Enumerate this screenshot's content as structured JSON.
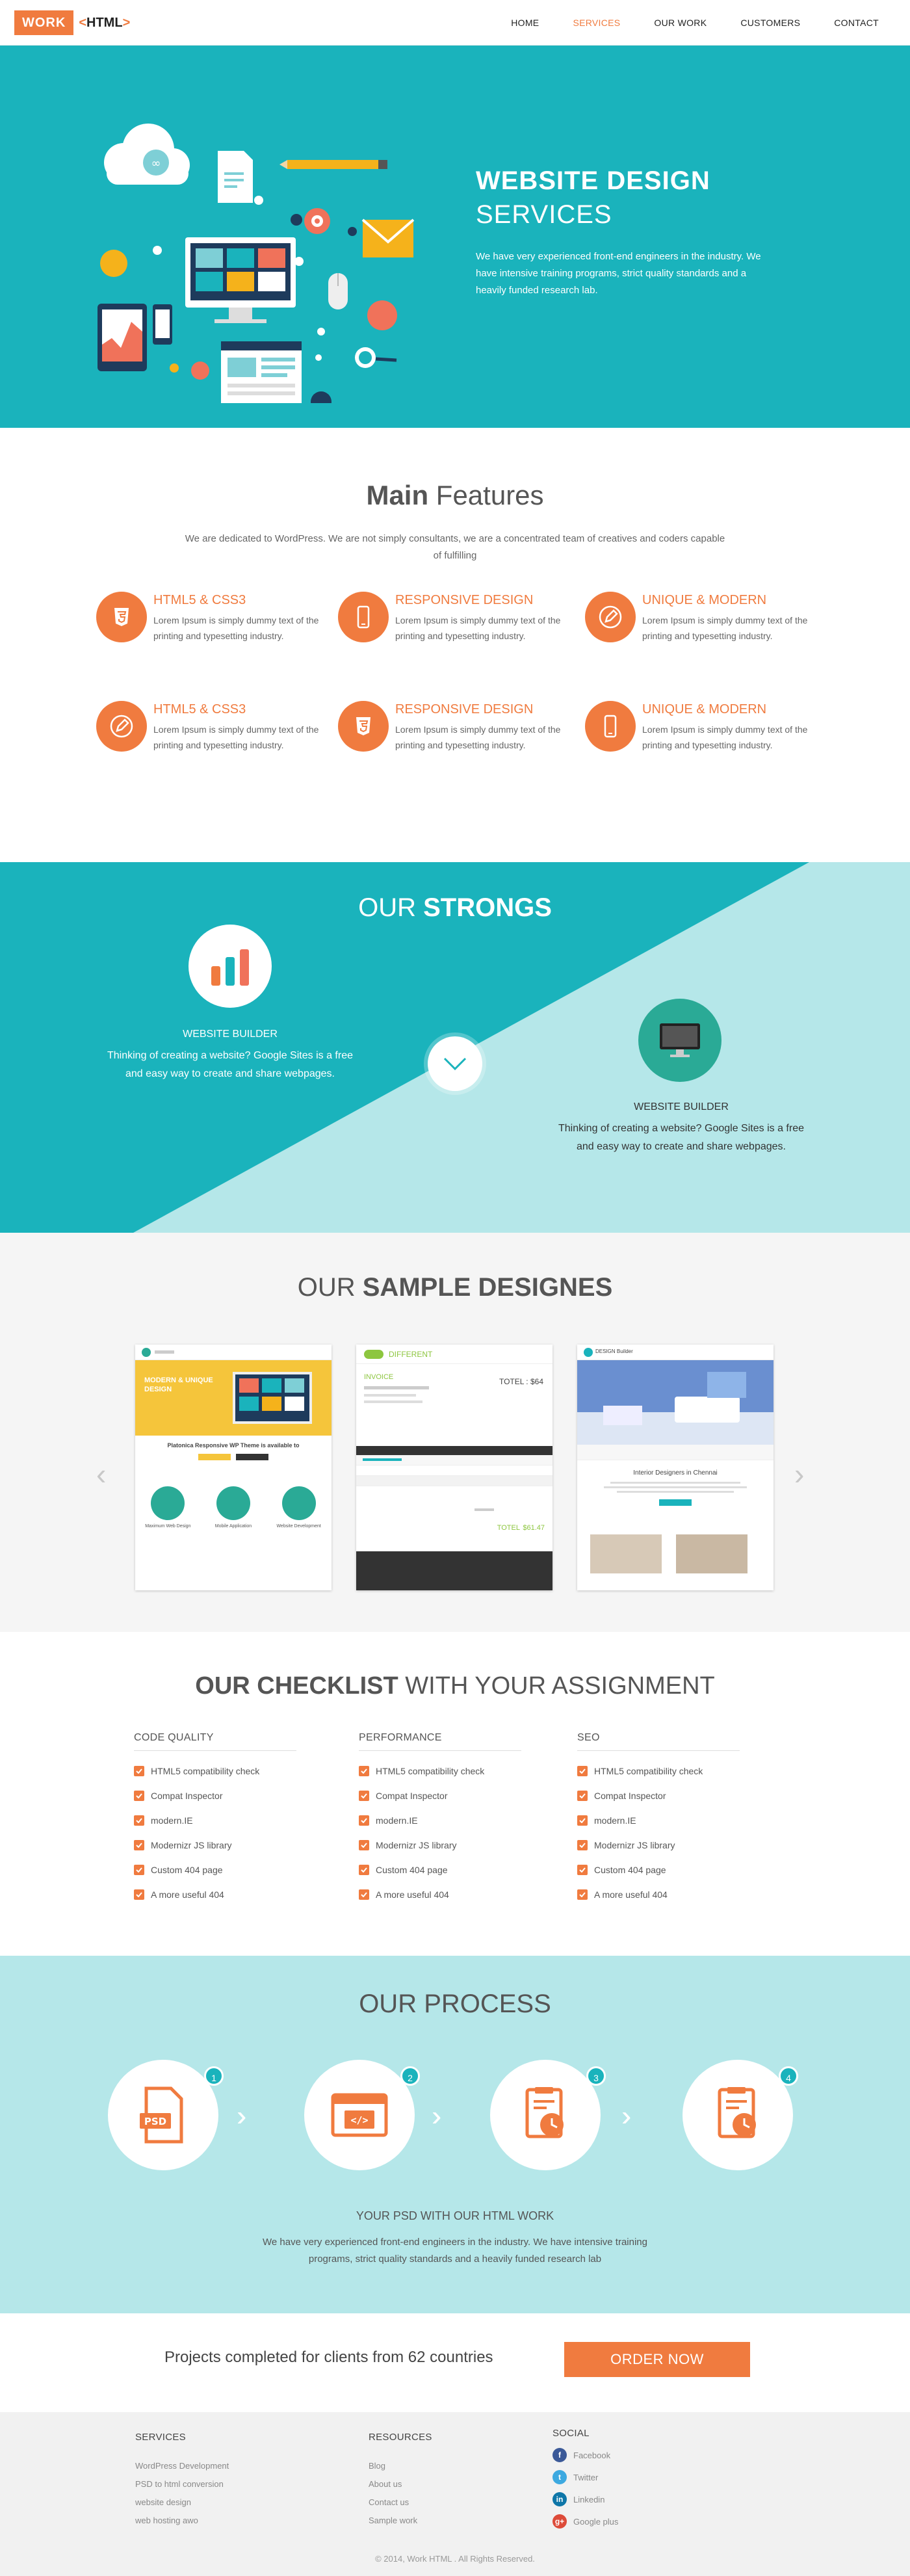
{
  "header": {
    "logo_work": "WORK",
    "logo_html": "HTML",
    "nav": [
      "HOME",
      "SERVICES",
      "OUR WORK",
      "CUSTOMERS",
      "CONTACT"
    ],
    "active_nav": "SERVICES"
  },
  "hero": {
    "title_bold": "WEBSITE DESIGN",
    "title_light": "SERVICES",
    "description": "We have very experienced front-end engineers in the industry. We have intensive training programs, strict quality standards and a heavily funded research lab."
  },
  "features": {
    "title_bold": "Main",
    "title_light": "Features",
    "subtitle": "We are dedicated to WordPress. We are not simply consultants, we are a concentrated team of creatives and coders capable of fulfilling",
    "items": [
      {
        "icon": "html5-icon",
        "title": "HTML5 & CSS3",
        "text": "Lorem Ipsum is simply dummy text of the printing and typesetting industry."
      },
      {
        "icon": "smartphone-icon",
        "title": "RESPONSIVE DESIGN",
        "text": "Lorem Ipsum is simply dummy text of the printing and typesetting industry."
      },
      {
        "icon": "pencil-icon",
        "title": "UNIQUE & MODERN",
        "text": "Lorem Ipsum is simply dummy text of the printing and typesetting industry."
      },
      {
        "icon": "pencil-icon",
        "title": "HTML5 & CSS3",
        "text": "Lorem Ipsum is simply dummy text of the printing and typesetting industry."
      },
      {
        "icon": "html5-icon",
        "title": "RESPONSIVE DESIGN",
        "text": "Lorem Ipsum is simply dummy text of the printing and typesetting industry."
      },
      {
        "icon": "smartphone-icon",
        "title": "UNIQUE & MODERN",
        "text": "Lorem Ipsum is simply dummy text of the printing and typesetting industry."
      }
    ]
  },
  "strongs": {
    "title_light": "OUR",
    "title_bold": "STRONGS",
    "items": [
      {
        "icon": "bar-chart-icon",
        "label": "WEBSITE BUILDER",
        "text": "Thinking of creating a website? Google Sites is a free and easy way to create and share webpages."
      },
      {
        "icon": "monitor-icon",
        "label": "WEBSITE BUILDER",
        "text": "Thinking of creating a website? Google Sites is a free and easy way to create and share webpages."
      }
    ]
  },
  "samples": {
    "title_light": "OUR",
    "title_bold": "SAMPLE DESIGNES",
    "card1": {
      "hero_text": "MODERN & UNIQUE DESIGN",
      "headline": "Platonica Responsive WP Theme is available to",
      "features": [
        "Maximum Web Design",
        "Mobile Application",
        "Website Development"
      ]
    },
    "card2": {
      "brand": "DIFFERENT",
      "heading": "INVOICE",
      "total": "TOTEL : $64",
      "footer_total_label": "TOTEL",
      "footer_total": "$61.47"
    },
    "card3": {
      "brand": "DESIGN Builder",
      "headline": "Interior Designers in Chennai"
    }
  },
  "checklist": {
    "title_bold": "OUR CHECKLIST",
    "title_light": "WITH YOUR ASSIGNMENT",
    "columns": [
      {
        "heading": "CODE QUALITY",
        "items": [
          "HTML5 compatibility check",
          "Compat Inspector",
          "modern.IE",
          "Modernizr JS library",
          "Custom 404 page",
          "A more useful 404"
        ]
      },
      {
        "heading": "PERFORMANCE",
        "items": [
          "HTML5 compatibility check",
          "Compat Inspector",
          "modern.IE",
          "Modernizr JS library",
          "Custom 404 page",
          "A more useful 404"
        ]
      },
      {
        "heading": "SEO",
        "items": [
          "HTML5 compatibility check",
          "Compat Inspector",
          "modern.IE",
          "Modernizr JS library",
          "Custom 404 page",
          "A more useful 404"
        ]
      }
    ]
  },
  "process": {
    "title": "OUR PROCESS",
    "steps": [
      {
        "num": "1",
        "icon": "psd-file-icon"
      },
      {
        "num": "2",
        "icon": "code-window-icon"
      },
      {
        "num": "3",
        "icon": "document-clock-icon"
      },
      {
        "num": "4",
        "icon": "document-clock-icon"
      }
    ],
    "label": "YOUR PSD WITH OUR HTML WORK",
    "description": "We have very experienced front-end engineers in the industry. We have intensive training programs, strict quality standards and a heavily funded research lab"
  },
  "cta": {
    "text": "Projects completed for clients from 62 countries",
    "button": "ORDER NOW"
  },
  "footer": {
    "services": {
      "heading": "SERVICES",
      "links": [
        "WordPress Development",
        "PSD to html conversion",
        "website design",
        "web hosting awo"
      ]
    },
    "resources": {
      "heading": "RESOURCES",
      "links": [
        "Blog",
        "About us",
        "Contact us",
        "Sample work"
      ]
    },
    "social": {
      "heading": "SOCIAL",
      "links": [
        "Facebook",
        "Twitter",
        "Linkedin",
        "Google plus"
      ]
    },
    "copyright": "© 2014, Work HTML . All Rights Reserved."
  },
  "colors": {
    "teal": "#1ab3bc",
    "light_teal": "#b5e7e9",
    "orange": "#f07b3f"
  }
}
